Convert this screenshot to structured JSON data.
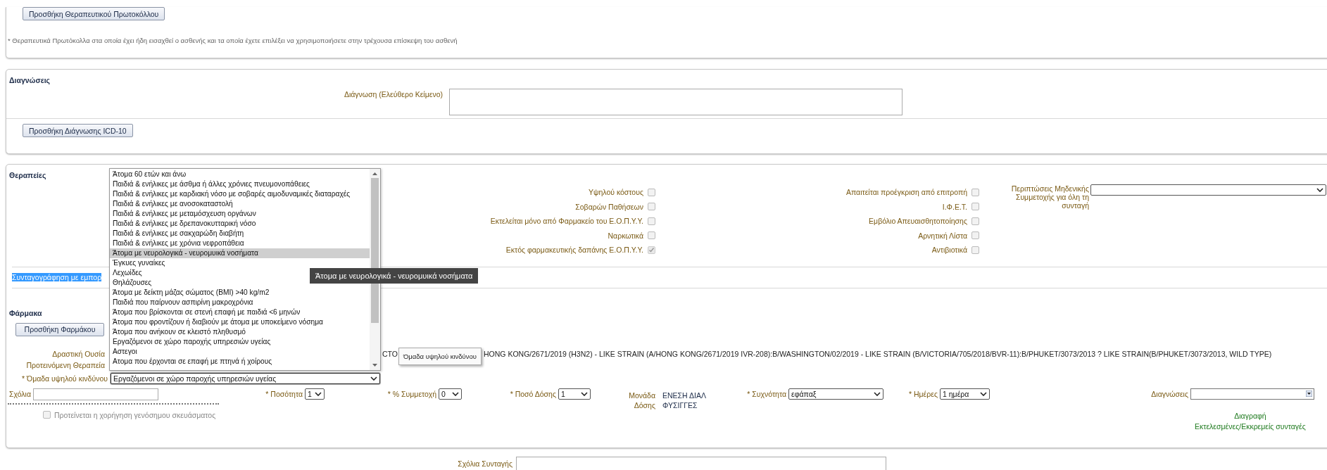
{
  "protocols": {
    "add_button": "Προσθήκη Θεραπευτικού Πρωτοκόλλου",
    "note": "* Θεραπευτικά Πρωτόκολλα στα οποία έχει ήδη εισαχθεί ο ασθενής και τα οποία έχετε επιλέξει να χρησιμοποιήσετε στην τρέχουσα επίσκεψη του ασθενή"
  },
  "diagnoses": {
    "title": "Διαγνώσεις",
    "free_text_label": "Διάγνωση (Ελεύθερο Κείμενο)",
    "add_button": "Προσθήκη Διάγνωσης ICD-10"
  },
  "therapies": {
    "title": "Θεραπείες",
    "flags_left": [
      {
        "label": "Υψηλού κόστους",
        "checked": false
      },
      {
        "label": "Σοβαρών Παθήσεων",
        "checked": false
      },
      {
        "label": "Εκτελείται μόνο από Φαρμακείο του Ε.Ο.Π.Υ.Υ.",
        "checked": false
      },
      {
        "label": "Ναρκωτικά",
        "checked": false
      },
      {
        "label": "Εκτός φαρμακευτικής δαπάνης Ε.Ο.Π.Υ.Υ.",
        "checked": true
      }
    ],
    "flags_right": [
      {
        "label": "Απαιτείται προέγκριση από επιτροπή",
        "checked": false
      },
      {
        "label": "Ι.Φ.Ε.Τ.",
        "checked": false
      },
      {
        "label": "Εμβόλιο Απευαισθητοποίησης",
        "checked": false
      },
      {
        "label": "Αρνητική Λίστα",
        "checked": false
      },
      {
        "label": "Αντιβιοτικά",
        "checked": false
      }
    ],
    "zero_participation_label": "Περιπτώσεις Μηδενικής Συμμετοχής για όλη τη συνταγή",
    "commercial_name": {
      "label": "Συνταγογράφηση με εμπορ",
      "highlighted": true
    }
  },
  "drugs": {
    "title": "Φάρμακα",
    "add_button": "Προσθήκη Φαρμάκου",
    "active_substance_label": "Δραστική Ουσία",
    "active_substance_value_parts": [
      "CTO",
      "HONG KONG/2671/2019 (H3N2) - LIKE STRAIN (A/HONG KONG/2671/2019 IVR-208):B/WASHINGTON/02/2019 - LIKE STRAIN (B/VICTORIA/705/2018/BVR-11):B/PHUKET/3073/2013 ? LIKE STRAIN(B/PHUKET/3073/2013, WILD TYPE)"
    ],
    "suggested_therapy_label": "Προτεινόμενη Θεραπεία",
    "risk_group": {
      "label": "* Όμαδα υψηλού κινδύνου",
      "value": "Εργαζόμενοι σε χώρο παροχής υπηρεσιών υγείας",
      "expanded": true,
      "tooltip": "Όμαδα υψηλού κινδύνου",
      "hover_tooltip": "Άτομα με νευρολογικά - νευρομυικά νοσήματα",
      "options": [
        {
          "label": "Άτομα 60 ετών και άνω",
          "highlighted": false
        },
        {
          "label": "Παιδιά & ενήλικες με άσθμα ή άλλες χρόνιες πνευμονοπάθειες",
          "highlighted": false
        },
        {
          "label": "Παιδιά & ενήλικες με καρδιακή νόσο με σοβαρές αιμοδυναμικές διαταραχές",
          "highlighted": false
        },
        {
          "label": "Παιδιά & ενήλικες με ανοσοκαταστολή",
          "highlighted": false
        },
        {
          "label": "Παιδιά & ενήλικες με μεταμόσχευση οργάνων",
          "highlighted": false
        },
        {
          "label": "Παιδιά & ενήλικες με δρεπανοκυτταρική νόσο",
          "highlighted": false
        },
        {
          "label": "Παιδιά & ενήλικες με σακχαρώδη διαβήτη",
          "highlighted": false
        },
        {
          "label": "Παιδιά & ενήλικες με χρόνια νεφροπάθεια",
          "highlighted": false
        },
        {
          "label": "Άτομα με νευρολογικά - νευρομυικά νοσήματα",
          "highlighted": true
        },
        {
          "label": "Έγκυες γυναίκες",
          "highlighted": false
        },
        {
          "label": "Λεχωίδες",
          "highlighted": false
        },
        {
          "label": "Θηλάζουσες",
          "highlighted": false
        },
        {
          "label": "Άτομα με δείκτη μάζας σώματος (BMI) >40 kg/m2",
          "highlighted": false
        },
        {
          "label": "Παιδιά που παίρνουν ασπιρίνη μακροχρόνια",
          "highlighted": false
        },
        {
          "label": "Άτομα που βρίσκονται σε στενή επαφή με παιδιά <6 μηνών",
          "highlighted": false
        },
        {
          "label": "Άτομα που φροντίζουν ή διαβιούν με άτομα με υποκείμενο νόσημα",
          "highlighted": false
        },
        {
          "label": "Άτομα που ανήκουν σε κλειστό πληθυσμό",
          "highlighted": false
        },
        {
          "label": "Εργαζόμενοι σε χώρο παροχής υπηρεσιών υγείας",
          "highlighted": false
        },
        {
          "label": "Αστεγοι",
          "highlighted": false
        },
        {
          "label": "Ατομα που έρχονται σε επαφή με πτηνά ή χοίρους",
          "highlighted": false
        }
      ]
    },
    "comments_label": "Σχόλια",
    "quantity": {
      "label": "* Ποσότητα",
      "value": "1"
    },
    "participation": {
      "label": "* % Συμμετοχή",
      "value": "0"
    },
    "dose_amount": {
      "label": "* Ποσό Δόσης",
      "value": "1"
    },
    "dose_unit": {
      "label": "Μονάδα Δόσης",
      "value": "ΕΝΕΣΗ ΔΙΑΛ ΦΥΣΙΓΓΕΣ"
    },
    "frequency": {
      "label": "* Συχνότητα",
      "value": "εφάπαξ"
    },
    "days": {
      "label": "* Ημέρες",
      "value": "1 ημέρα"
    },
    "diagnoses_label": "Διαγνώσεις",
    "generic": {
      "label": "Προτείνεται η χορήγηση γενόσημου σκευάσματος",
      "checked": false
    },
    "links": [
      "Διαγραφή",
      "Εκτελεσμένες/Εκκρεμείς συνταγές"
    ]
  },
  "prescription_comments_label": "Σχόλια Συνταγής"
}
